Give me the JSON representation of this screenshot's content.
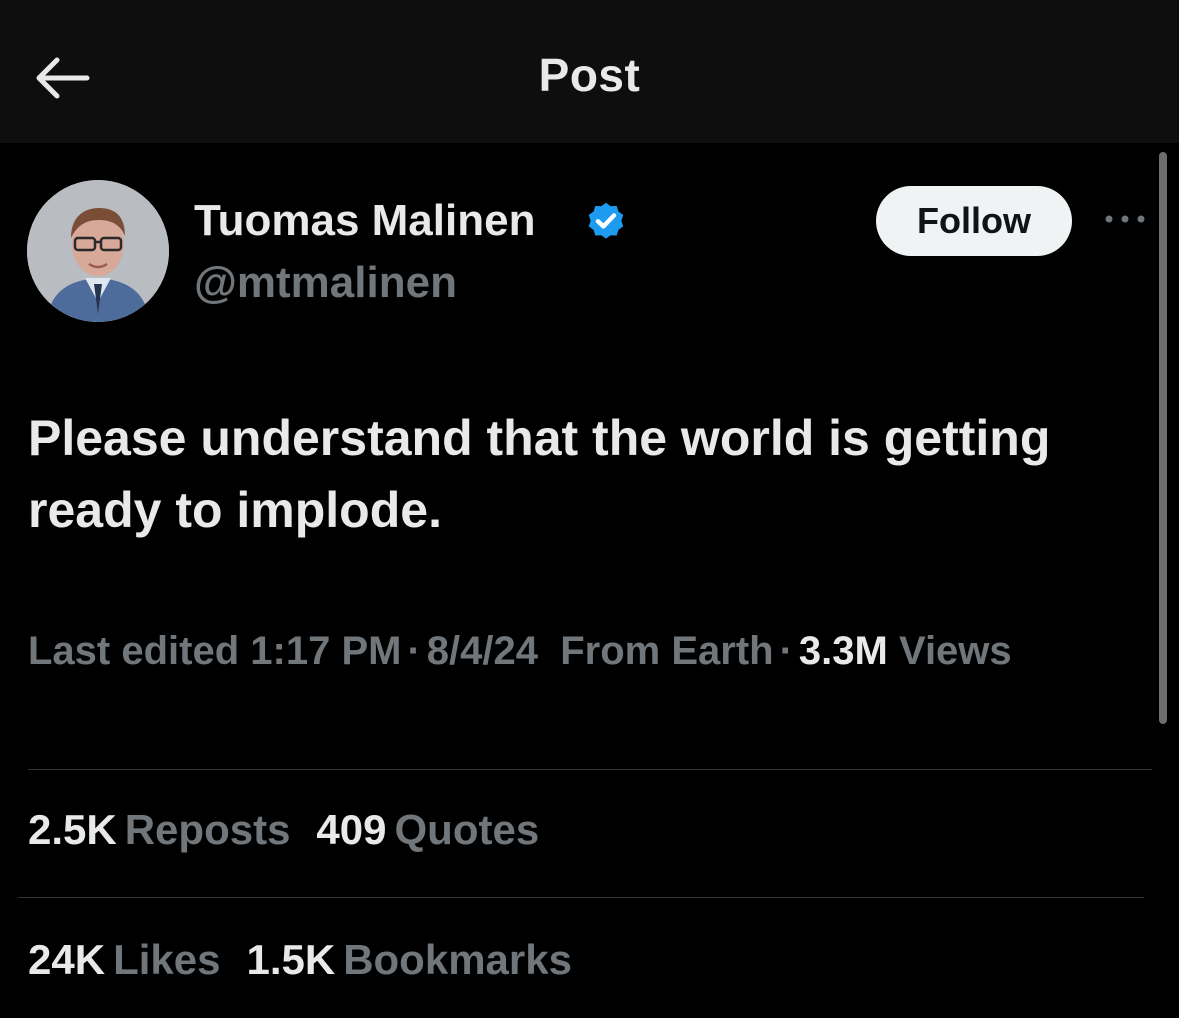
{
  "header": {
    "title": "Post",
    "back_icon": "arrow-left-icon"
  },
  "author": {
    "name": "Tuomas Malinen",
    "handle": "@mtmalinen",
    "verified_icon": "verified-badge-icon",
    "verified_color": "#1d9bf0",
    "follow_label": "Follow",
    "more_icon": "more-horizontal-icon"
  },
  "post": {
    "text": "Please understand that the world is getting ready to implode."
  },
  "meta": {
    "edited_label": "Last edited",
    "time": "1:17 PM",
    "date": "8/4/24",
    "source": "From Earth",
    "views_count": "3.3M",
    "views_label": "Views"
  },
  "stats": {
    "reposts_count": "2.5K",
    "reposts_label": "Reposts",
    "quotes_count": "409",
    "quotes_label": "Quotes",
    "likes_count": "24K",
    "likes_label": "Likes",
    "bookmarks_count": "1.5K",
    "bookmarks_label": "Bookmarks"
  },
  "colors": {
    "background": "#000000",
    "text_primary": "#e7e9ea",
    "text_secondary": "#71767b",
    "divider": "#2f3336"
  }
}
